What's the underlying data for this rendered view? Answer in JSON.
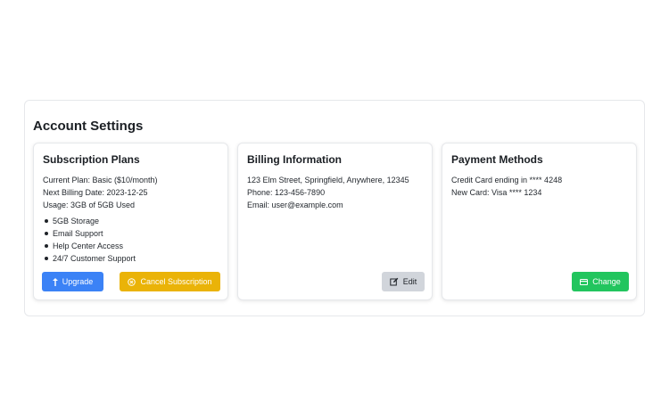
{
  "page": {
    "title": "Account Settings"
  },
  "subscription": {
    "title": "Subscription Plans",
    "current_plan": "Current Plan: Basic ($10/month)",
    "next_billing": "Next Billing Date: 2023-12-25",
    "usage": "Usage: 3GB of 5GB Used",
    "features": [
      "5GB Storage",
      "Email Support",
      "Help Center Access",
      "24/7 Customer Support"
    ],
    "upgrade_label": "Upgrade",
    "upgrade_icon": "arrow-up-icon",
    "cancel_label": "Cancel Subscription",
    "cancel_icon": "x-circle-icon"
  },
  "billing": {
    "title": "Billing Information",
    "address": "123 Elm Street, Springfield, Anywhere, 12345",
    "phone": "Phone: 123-456-7890",
    "email": "Email: user@example.com",
    "edit_label": "Edit",
    "edit_icon": "edit-icon"
  },
  "payment": {
    "title": "Payment Methods",
    "card_current": "Credit Card ending in **** 4248",
    "card_new": "New Card: Visa **** 1234",
    "change_label": "Change",
    "change_icon": "credit-card-icon"
  },
  "colors": {
    "upgrade": "#3b82f6",
    "cancel": "#eab308",
    "edit": "#d1d5db",
    "change": "#22c55e"
  }
}
